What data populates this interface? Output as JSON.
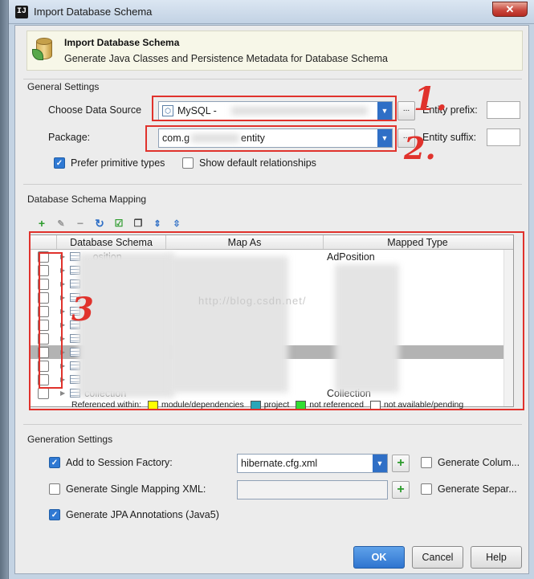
{
  "window": {
    "title": "Import Database Schema",
    "close_glyph": "✕"
  },
  "header": {
    "title": "Import Database Schema",
    "subtitle": "Generate Java Classes and Persistence Metadata for Database Schema"
  },
  "general": {
    "section_label": "General Settings",
    "data_source_label": "Choose Data Source",
    "data_source_value": "MySQL -",
    "package_label": "Package:",
    "package_value_prefix": "com.g",
    "package_value_suffix": "entity",
    "more_label": "...",
    "entity_prefix_label": "Entity prefix:",
    "entity_suffix_label": "Entity suffix:",
    "prefer_primitive_label": "Prefer primitive types",
    "prefer_primitive_checked": true,
    "show_relationships_label": "Show default relationships",
    "show_relationships_checked": false
  },
  "mapping": {
    "section_label": "Database Schema Mapping",
    "toolbar_icons": [
      "add-icon",
      "edit-icon",
      "remove-icon",
      "refresh-icon",
      "check-all-icon",
      "copy-icon",
      "expand-icon",
      "collapse-icon"
    ],
    "columns": [
      "Database Schema",
      "Map As",
      "Mapped Type"
    ],
    "rows": [
      {
        "schema": "...osition",
        "type": "AdPosition",
        "checked": false
      },
      {
        "schema": "",
        "type": "",
        "checked": false
      },
      {
        "schema": "",
        "type": "",
        "checked": false
      },
      {
        "schema": "",
        "type": "",
        "checked": false
      },
      {
        "schema": "",
        "type": "",
        "checked": false
      },
      {
        "schema": "",
        "type": "",
        "checked": false
      },
      {
        "schema": "",
        "type": "",
        "checked": false
      },
      {
        "schema": "",
        "type": "",
        "checked": false,
        "selected": true
      },
      {
        "schema": "",
        "type": "",
        "checked": false
      },
      {
        "schema": "",
        "type": "",
        "checked": false
      },
      {
        "schema": "collection",
        "type": "Collection",
        "checked": false
      }
    ],
    "watermark": "http://blog.csdn.net/",
    "legend": {
      "prefix": "Referenced within:",
      "items": [
        {
          "label": "module/dependencies",
          "color": "#ffff00"
        },
        {
          "label": "project",
          "color": "#2aa6b8"
        },
        {
          "label": "not referenced",
          "color": "#33dd33"
        },
        {
          "label": "not available/pending",
          "color": "#ffffff"
        }
      ]
    }
  },
  "generation": {
    "section_label": "Generation Settings",
    "session_factory_label": "Add to Session Factory:",
    "session_factory_checked": true,
    "session_factory_value": "hibernate.cfg.xml",
    "generate_column_label": "Generate Colum...",
    "single_mapping_label": "Generate Single Mapping XML:",
    "single_mapping_checked": false,
    "generate_separate_label": "Generate Separ...",
    "jpa_label": "Generate JPA Annotations (Java5)",
    "jpa_checked": true
  },
  "buttons": {
    "ok": "OK",
    "cancel": "Cancel",
    "help": "Help"
  },
  "annotations": {
    "one": "1.",
    "two": "2.",
    "three": "3"
  }
}
